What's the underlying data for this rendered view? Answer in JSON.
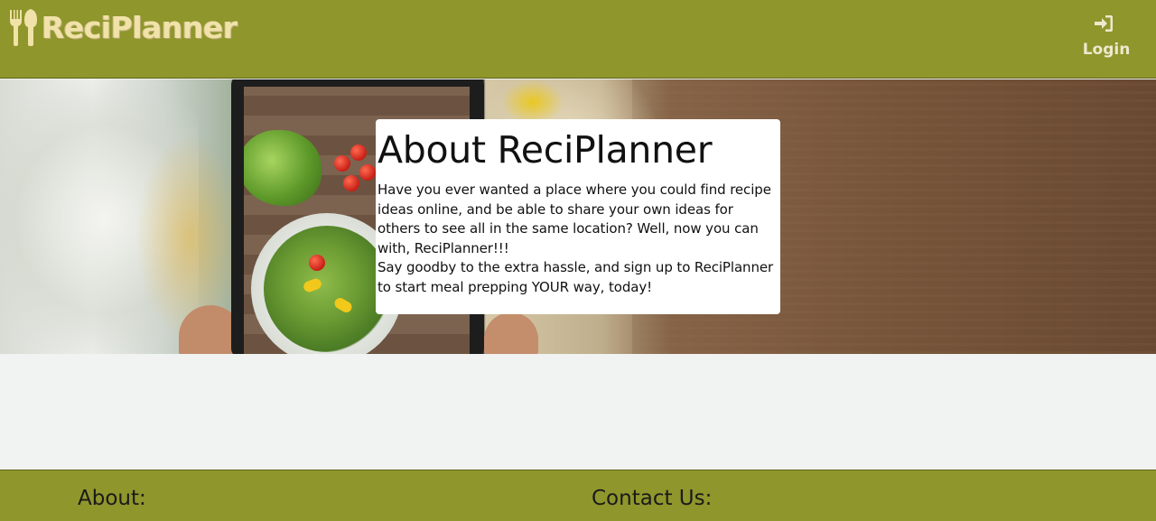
{
  "navbar": {
    "brand_text": "ReciPlanner",
    "brand_icon": "fork-spoon-icon",
    "login_label": "Login",
    "login_icon": "sign-in-icon",
    "background_color": "#8f962c",
    "brand_color": "#f0e2a8"
  },
  "hero": {
    "background_image": "phone photographing salad on wooden table"
  },
  "about": {
    "title": "About ReciPlanner",
    "paragraph1": "Have you ever wanted a place where you could find recipe ideas online, and be able to share your own ideas for others to see all in the same location? Well, now you can with, ReciPlanner!!!",
    "paragraph2": "Say goodby to the extra hassle, and sign up to ReciPlanner to start meal prepping YOUR way, today!"
  },
  "footer": {
    "about_heading": "About:",
    "contact_heading": "Contact Us:",
    "background_color": "#8f962c"
  }
}
